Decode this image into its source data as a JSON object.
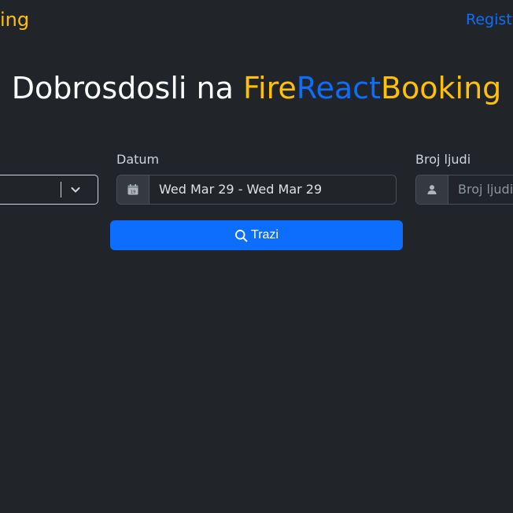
{
  "navbar": {
    "brand_partial": "ing",
    "register_partial": "Regist"
  },
  "hero": {
    "prefix": "Dobrosdosli na ",
    "brand_fire": "Fire",
    "brand_react": "React",
    "brand_booking": "Booking"
  },
  "form": {
    "date_label": "Datum",
    "date_value": "Wed Mar 29 - Wed Mar 29",
    "people_label": "Broj ljudi",
    "people_placeholder": "Broj ljudi",
    "search_label": "Trazi"
  },
  "colors": {
    "background": "#212529",
    "brand_yellow": "#ffc107",
    "brand_blue": "#0d6efd",
    "button": "#0d6efd"
  },
  "icons": {
    "location_select": "chevron-down-icon",
    "date": "calendar-icon",
    "people": "person-icon",
    "search": "search-icon"
  }
}
